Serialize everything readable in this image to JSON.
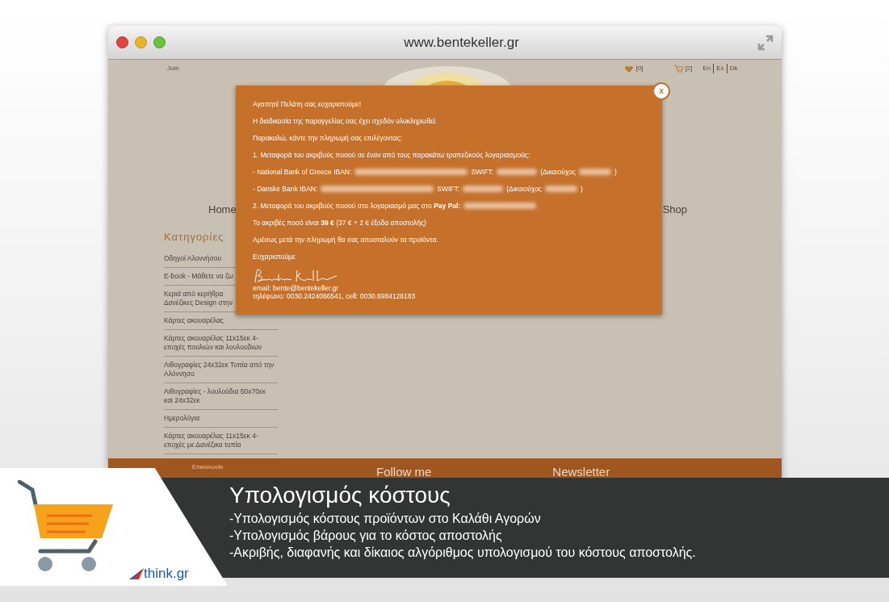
{
  "browser": {
    "title": "www.bentekeller.gr"
  },
  "topbar": {
    "join": "Join",
    "wishlist": "[0]",
    "cart": "[2]",
    "languages": [
      "En",
      "Ελ",
      "Dk"
    ]
  },
  "nav": {
    "left": "Home",
    "right": "Shop"
  },
  "sidebar": {
    "title": "Κατηγορίες",
    "items": [
      {
        "lines": [
          "Οδηγοί Αλοννήσου"
        ]
      },
      {
        "lines": [
          "E-book - Μάθετε να ζω"
        ]
      },
      {
        "lines": [
          "Κεριά από κερήθρα",
          "Δανέζικες Design στην"
        ]
      },
      {
        "lines": [
          "Κάρτες ακουαρέλας"
        ]
      },
      {
        "lines": [
          "Κάρτες ακουαρέλας 11x15εκ 4-",
          "εποχές πουλιών και λουλουδιων"
        ]
      },
      {
        "lines": [
          "Λιθογραφίες 24x32εκ Τοπία από την",
          "Αλόννησο"
        ]
      },
      {
        "lines": [
          "Λιθογραφίες - λουλούδια 50x70εκ",
          "και 24x32εκ"
        ]
      },
      {
        "lines": [
          "Ημερολόγια"
        ]
      },
      {
        "lines": [
          "Κάρτες ακουαρέλας 11x15εκ 4-",
          "εποχές με Δανέζικα τοπία"
        ]
      }
    ]
  },
  "modal": {
    "close": "x",
    "paragraphs": [
      {
        "kind": "text",
        "text": "Αγαπητέ Πελάτη σας ευχαριστούμε!"
      },
      {
        "kind": "text",
        "text": "Η διαδικασία της παραγγελίας σας έχει σχεδόν ολοκληρωθεί."
      },
      {
        "kind": "text",
        "text": "Παρακαλώ, κάντε την πληρωμή σας επιλέγοντας:"
      },
      {
        "kind": "text",
        "text": "1. Μεταφορά του ακριβούς ποσού σε έναν από τους παρακάτω τραπεζικούς λογαριασμούς:"
      },
      {
        "kind": "bank",
        "parts": [
          "- National Bank of Greece IBAN:",
          "SWIFT:",
          "(Δικαιούχος",
          ")"
        ]
      },
      {
        "kind": "bank",
        "parts": [
          "- Danske Bank IBAN:",
          "SWIFT:",
          "(Δικαιούχος",
          ")"
        ]
      },
      {
        "kind": "paypal",
        "text": "2. Μεταφορά του ακριβούς ποσού στο λογαριασμό μας στο **Pay Pal:**"
      },
      {
        "kind": "text",
        "text": "Το ακριβές ποσό είναι **39 €** (37 € + 2 € έξοδα αποστολής)"
      },
      {
        "kind": "text",
        "text": "Αμέσως μετά την πληρωμή θα σας αποσταλούν τα προϊόντα."
      },
      {
        "kind": "text",
        "text": "Ευχαριστούμε"
      }
    ],
    "email": "email: bente@bentekeller.gr",
    "phone": "τηλέφωνο: 0030.2424066541, cell: 0030.6984126183"
  },
  "footer": {
    "link": "Επικοινωνία",
    "follow": "Follow me",
    "newsletter": "Newsletter"
  },
  "banner": {
    "logo": "think.gr",
    "title": "Υπολογισμός κόστους",
    "lines": [
      "-Υπολογισμός κόστους προϊόντων στο Καλάθι Αγορών",
      "-Υπολογισμός βάρους για το κόστος αποστολής",
      "-Ακριβής, διαφανής και δίκαιος αλγόριθμος υπολογισμού του κόστους αποστολής."
    ]
  }
}
